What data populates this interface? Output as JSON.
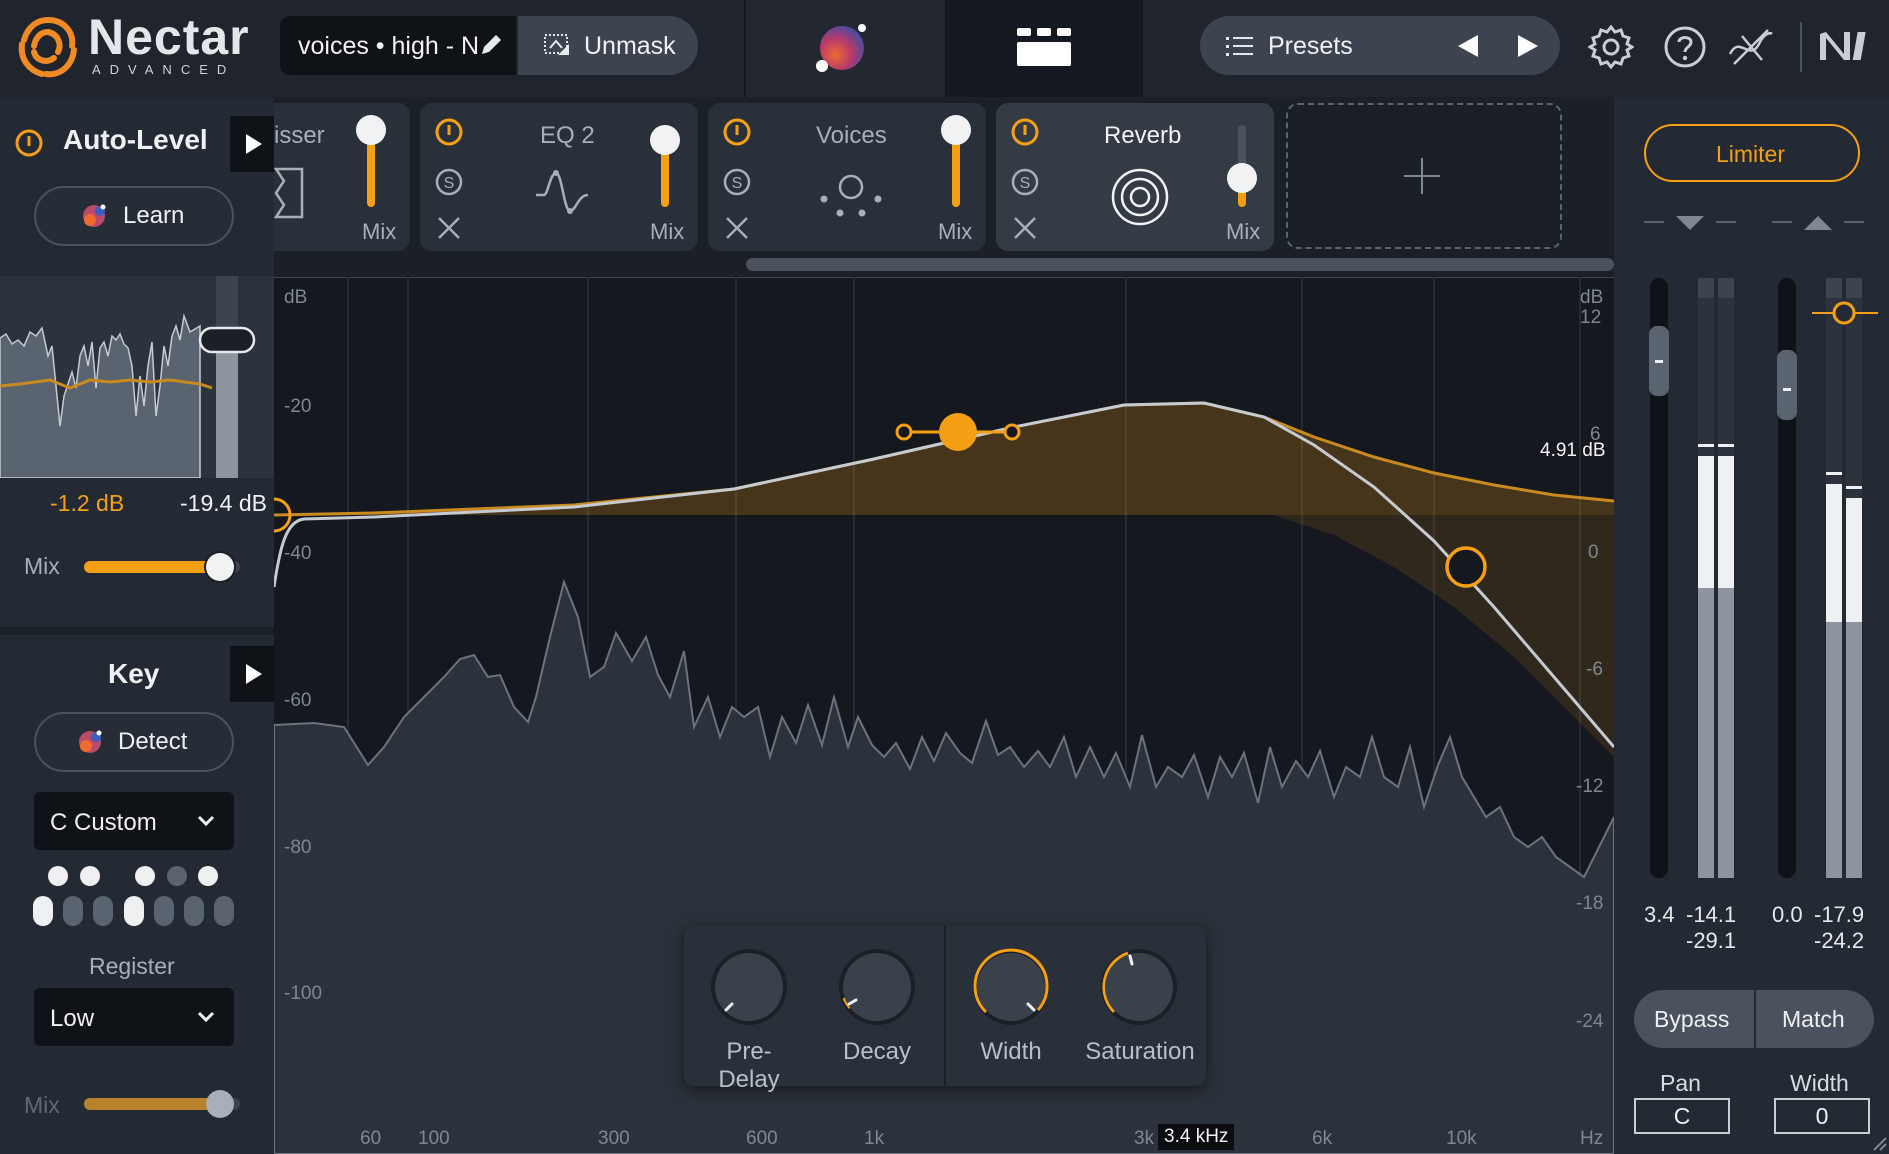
{
  "app": {
    "name": "Nectar",
    "edition": "ADVANCED"
  },
  "header": {
    "preset_name": "voices • high - Ne",
    "unmask_label": "Unmask",
    "presets_label": "Presets"
  },
  "modules": [
    {
      "name": "isser",
      "mix_label": "Mix"
    },
    {
      "name": "EQ 2",
      "mix_label": "Mix"
    },
    {
      "name": "Voices",
      "mix_label": "Mix"
    },
    {
      "name": "Reverb",
      "mix_label": "Mix"
    }
  ],
  "auto_level": {
    "title": "Auto-Level",
    "learn_label": "Learn",
    "target_value": "-1.2 dB",
    "gain_value": "-19.4 dB",
    "mix_label": "Mix",
    "mix_level": 0.87
  },
  "key": {
    "title": "Key",
    "detect_label": "Detect",
    "scale_value": "C Custom",
    "register_label": "Register",
    "register_value": "Low",
    "mix_label": "Mix",
    "mix_level": 0.87
  },
  "eq": {
    "db_unit_left": "dB",
    "db_unit_right": "dB",
    "left_scale": [
      "-20",
      "-40",
      "-60",
      "-80",
      "-100"
    ],
    "right_scale": [
      "12",
      "6",
      "0",
      "-6",
      "-12",
      "-18",
      "-24"
    ],
    "freq_labels": [
      "60",
      "100",
      "300",
      "600",
      "1k",
      "3k",
      "6k",
      "10k",
      "Hz"
    ],
    "band_gain_readout": "4.91 dB",
    "freq_readout": "3.4 kHz"
  },
  "reverb_controls": {
    "knobs": [
      {
        "label": "Pre-Delay"
      },
      {
        "label": "Decay"
      },
      {
        "label": "Width"
      },
      {
        "label": "Saturation"
      }
    ]
  },
  "limiter": {
    "label": "Limiter",
    "in_gain": "3.4",
    "in_peak": "-14.1",
    "in_rms": "-29.1",
    "out_gain": "0.0",
    "out_peak": "-17.9",
    "out_rms": "-24.2",
    "bypass_label": "Bypass",
    "match_label": "Match",
    "pan_label": "Pan",
    "pan_value": "C",
    "width_label": "Width",
    "width_value": "0"
  },
  "colors": {
    "accent": "#f5a014",
    "panel": "#242a33",
    "background": "#1b1f26"
  }
}
